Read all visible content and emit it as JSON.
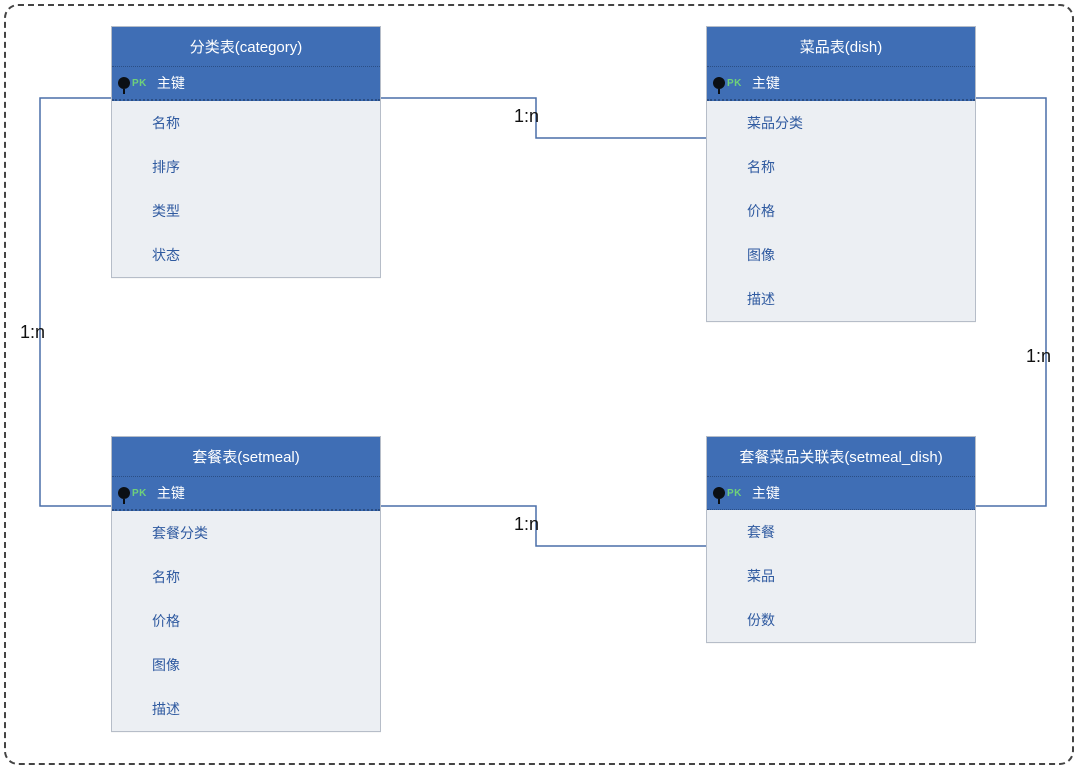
{
  "entities": {
    "category": {
      "title": "分类表(category)",
      "pk": "主键",
      "fields": [
        "名称",
        "排序",
        "类型",
        "状态"
      ]
    },
    "dish": {
      "title": "菜品表(dish)",
      "pk": "主键",
      "fields": [
        "菜品分类",
        "名称",
        "价格",
        "图像",
        "描述"
      ]
    },
    "setmeal": {
      "title": "套餐表(setmeal)",
      "pk": "主键",
      "fields": [
        "套餐分类",
        "名称",
        "价格",
        "图像",
        "描述"
      ]
    },
    "setmeal_dish": {
      "title": "套餐菜品关联表(setmeal_dish)",
      "pk": "主键",
      "fields": [
        "套餐",
        "菜品",
        "份数"
      ]
    }
  },
  "relationships": [
    {
      "label": "1:n",
      "from": "category",
      "to": "dish"
    },
    {
      "label": "1:n",
      "from": "category",
      "to": "setmeal"
    },
    {
      "label": "1:n",
      "from": "setmeal",
      "to": "setmeal_dish"
    },
    {
      "label": "1:n",
      "from": "dish",
      "to": "setmeal_dish"
    }
  ],
  "pk_badge": "PK"
}
